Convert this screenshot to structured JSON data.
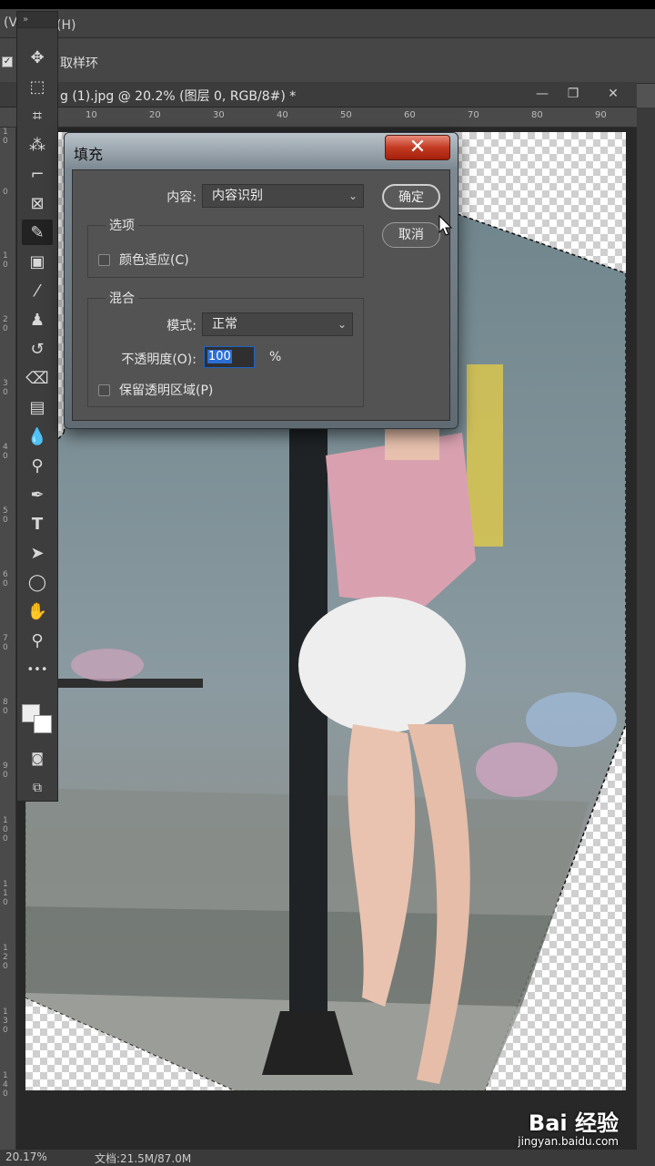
{
  "menubar": {
    "left_text": "(V",
    "help_menu": "助(H)"
  },
  "options_bar": {
    "sample_ring_label": "取样环"
  },
  "document": {
    "tab_title": "g (1).jpg @ 20.2% (图层 0, RGB/8#) *",
    "minimize": "—",
    "restore": "❐",
    "close": "✕"
  },
  "ruler": {
    "h_ticks": [
      "10",
      "20",
      "30",
      "40",
      "50",
      "60",
      "70",
      "80",
      "90"
    ],
    "v_ticks": [
      "10",
      "0",
      "10",
      "20",
      "30",
      "40",
      "50",
      "60",
      "70",
      "80",
      "90",
      "100",
      "110",
      "120",
      "130",
      "140"
    ]
  },
  "toolbar": {
    "grip": "»",
    "tools": [
      {
        "name": "move-tool",
        "glyph": "✥"
      },
      {
        "name": "marquee-tool",
        "glyph": "⬚"
      },
      {
        "name": "lasso-tool",
        "glyph": "⌗"
      },
      {
        "name": "magic-wand-tool",
        "glyph": "⁂"
      },
      {
        "name": "crop-tool",
        "glyph": "⌐"
      },
      {
        "name": "frame-tool",
        "glyph": "⊠"
      },
      {
        "name": "eyedropper-tool",
        "glyph": "✎"
      },
      {
        "name": "healing-tool",
        "glyph": "▣"
      },
      {
        "name": "brush-tool",
        "glyph": "⁄"
      },
      {
        "name": "stamp-tool",
        "glyph": "♟"
      },
      {
        "name": "history-brush-tool",
        "glyph": "↺"
      },
      {
        "name": "eraser-tool",
        "glyph": "⌫"
      },
      {
        "name": "gradient-tool",
        "glyph": "▤"
      },
      {
        "name": "blur-tool",
        "glyph": "💧"
      },
      {
        "name": "dodge-tool",
        "glyph": "⚲"
      },
      {
        "name": "pen-tool",
        "glyph": "✒"
      },
      {
        "name": "type-tool",
        "glyph": "T"
      },
      {
        "name": "path-select-tool",
        "glyph": "➤"
      },
      {
        "name": "ellipse-tool",
        "glyph": "◯"
      },
      {
        "name": "hand-tool",
        "glyph": "✋"
      },
      {
        "name": "zoom-tool",
        "glyph": "⚲"
      },
      {
        "name": "more-tools",
        "glyph": "•••"
      }
    ]
  },
  "dialog": {
    "title": "填充",
    "close_glyph": "✕",
    "content_label": "内容:",
    "content_value": "内容识别",
    "ok": "确定",
    "cancel": "取消",
    "options_group": "选项",
    "color_adapt": "颜色适应(C)",
    "blend_group": "混合",
    "mode_label": "模式:",
    "mode_value": "正常",
    "opacity_label": "不透明度(O):",
    "opacity_value": "100",
    "opacity_unit": "%",
    "preserve_transparency": "保留透明区域(P)"
  },
  "status": {
    "zoom": "20.17%",
    "doc": "文档:21.5M/87.0M"
  },
  "watermark": {
    "brand": "Bai 经验",
    "url": "jingyan.baidu.com"
  },
  "colors": {
    "accent_blue": "#2b6fd6",
    "close_red": "#c43a22",
    "panel": "#535353"
  }
}
